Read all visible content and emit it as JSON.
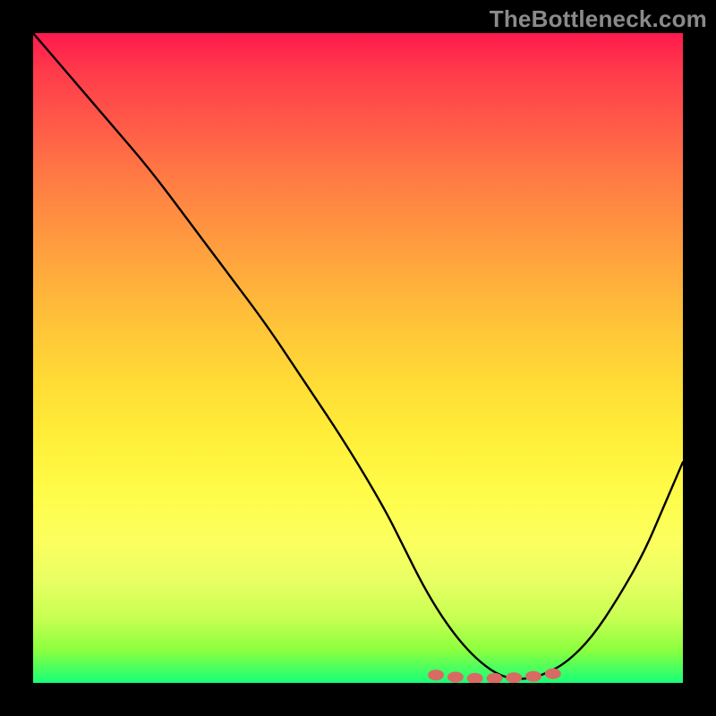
{
  "watermark": "TheBottleneck.com",
  "chart_data": {
    "type": "line",
    "title": "",
    "xlabel": "",
    "ylabel": "",
    "xlim": [
      0,
      100
    ],
    "ylim": [
      0,
      100
    ],
    "series": [
      {
        "name": "bottleneck-curve",
        "x": [
          0,
          6,
          12,
          18,
          24,
          30,
          36,
          42,
          48,
          54,
          57,
          60,
          63,
          66,
          69,
          72,
          75,
          78,
          82,
          86,
          90,
          94,
          97,
          100
        ],
        "values": [
          100,
          93,
          86,
          79,
          71,
          63,
          55,
          46,
          37,
          27,
          21,
          15,
          10,
          6,
          3,
          1,
          0.5,
          1,
          3,
          7,
          13,
          20,
          27,
          34
        ]
      },
      {
        "name": "minimum-markers",
        "x": [
          62,
          65,
          68,
          71,
          74,
          77,
          80
        ],
        "values": [
          1.2,
          0.9,
          0.7,
          0.7,
          0.8,
          1.0,
          1.4
        ]
      }
    ],
    "gradient_stops": [
      {
        "pos": 0.0,
        "color": "#ff1a4d"
      },
      {
        "pos": 0.14,
        "color": "#ff5a48"
      },
      {
        "pos": 0.3,
        "color": "#ff9440"
      },
      {
        "pos": 0.46,
        "color": "#ffc738"
      },
      {
        "pos": 0.62,
        "color": "#ffee39"
      },
      {
        "pos": 0.78,
        "color": "#fcff5e"
      },
      {
        "pos": 0.9,
        "color": "#c8ff52"
      },
      {
        "pos": 1.0,
        "color": "#16ff78"
      }
    ],
    "marker_color": "#d86a63"
  }
}
